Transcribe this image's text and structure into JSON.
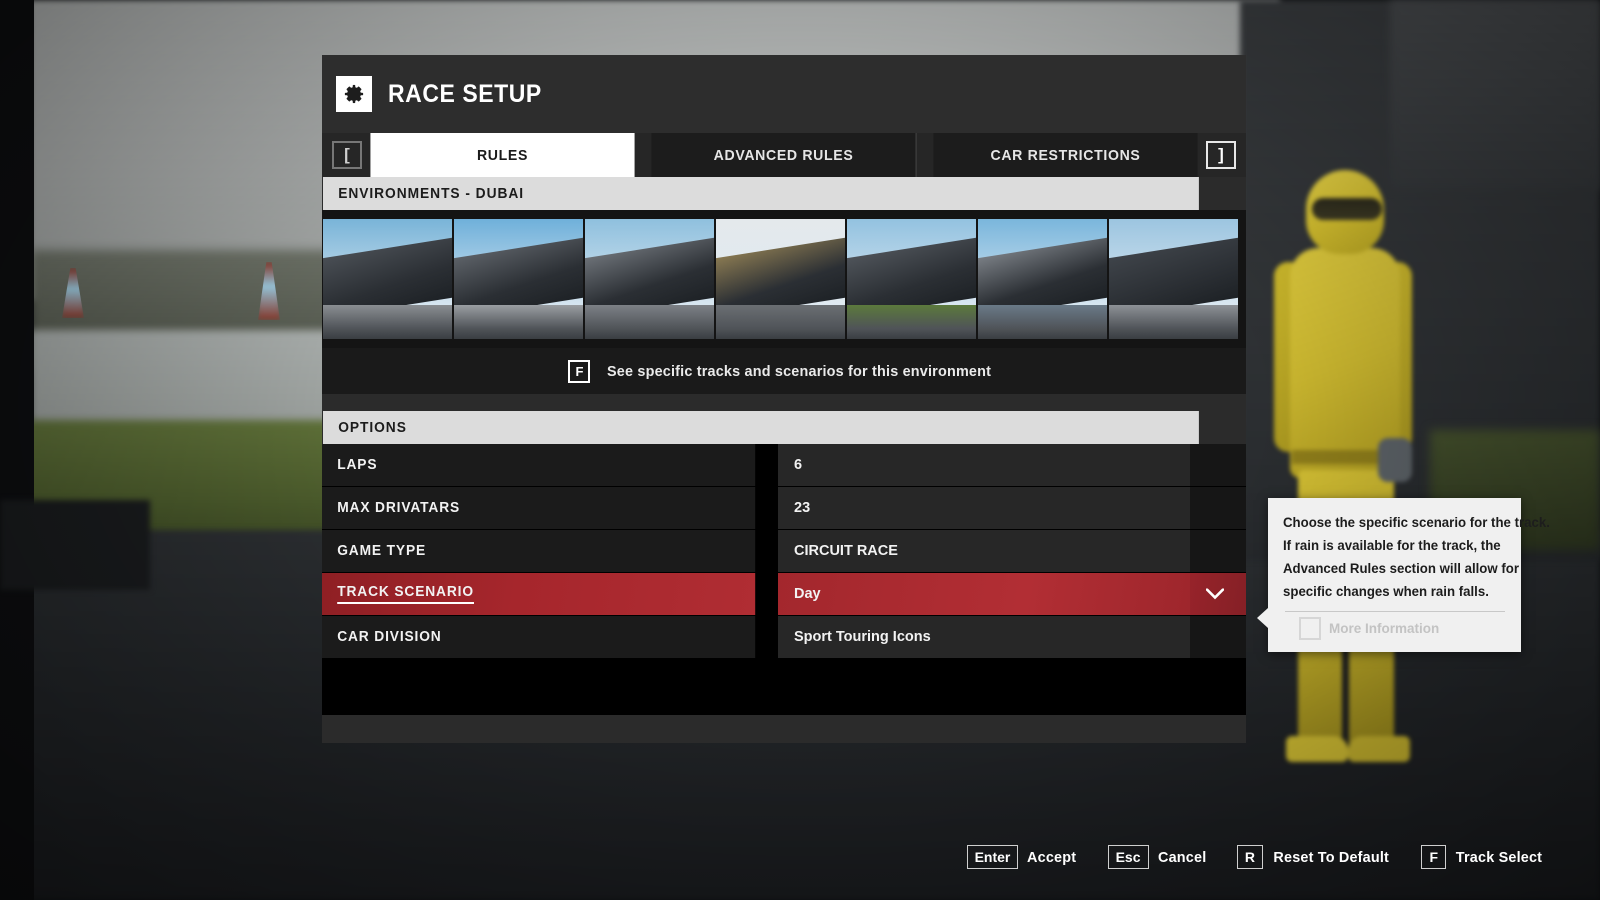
{
  "window": {
    "title": "RACE SETUP",
    "icon": "gear-icon"
  },
  "nav": {
    "prev_bracket": "[",
    "next_bracket": "]"
  },
  "tabs": [
    {
      "label": "RULES",
      "active": true
    },
    {
      "label": "ADVANCED RULES",
      "active": false
    },
    {
      "label": "CAR RESTRICTIONS",
      "active": false
    }
  ],
  "environments": {
    "header": "ENVIRONMENTS - DUBAI",
    "selected_index": 3,
    "thumbnails": [
      {
        "name": "circuit-de-catalunya",
        "sky": "#79b4d8",
        "stand": "#4a4f55",
        "ground": "#8a8e92"
      },
      {
        "name": "suzuka-circuit",
        "sky": "#6fb0da",
        "stand": "#5d6268",
        "ground": "#9a9ea2"
      },
      {
        "name": "daytona-speedway",
        "sky": "#8fc0de",
        "stand": "#6d7278",
        "ground": "#7d8186"
      },
      {
        "name": "dubai-autodrome",
        "sky": "#e4e9ec",
        "stand": "#8a7a52",
        "ground": "#6b6f73"
      },
      {
        "name": "brands-hatch",
        "sky": "#93c2e0",
        "stand": "#4f545a",
        "ground": "#5c7a3c"
      },
      {
        "name": "yas-marina-circuit",
        "sky": "#7ab6dc",
        "stand": "#7a7f85",
        "ground": "#6a7a88"
      },
      {
        "name": "indianapolis-motor-speedway",
        "sky": "#9cc5e0",
        "stand": "#3f444a",
        "ground": "#8d9196"
      }
    ],
    "hint_key": "F",
    "hint_text": "See specific tracks and scenarios for this environment"
  },
  "options": {
    "header": "OPTIONS",
    "rows": [
      {
        "label": "LAPS",
        "value": "6",
        "selected": false
      },
      {
        "label": "MAX DRIVATARS",
        "value": "23",
        "selected": false
      },
      {
        "label": "GAME TYPE",
        "value": "CIRCUIT RACE",
        "selected": false
      },
      {
        "label": "TRACK SCENARIO",
        "value": "Day",
        "selected": true
      },
      {
        "label": "CAR DIVISION",
        "value": "Sport Touring Icons",
        "selected": false
      }
    ]
  },
  "tooltip": {
    "lines": [
      "Choose the specific scenario for the track.",
      "If rain is available for the track, the",
      "Advanced Rules section will allow for",
      "specific changes when rain falls."
    ],
    "more_key": "",
    "more_label": "More Information"
  },
  "actions": [
    {
      "key": "Enter",
      "label": "Accept"
    },
    {
      "key": "Esc",
      "label": "Cancel"
    },
    {
      "key": "R",
      "label": "Reset To Default"
    },
    {
      "key": "F",
      "label": "Track Select"
    }
  ],
  "colors": {
    "selection_red": "#a6262c",
    "panel_bg": "#2b2b2b",
    "section_header_bg": "#dcdcdc",
    "active_tab_bg": "#ffffff",
    "tooltip_bg": "#f0f0f0"
  }
}
